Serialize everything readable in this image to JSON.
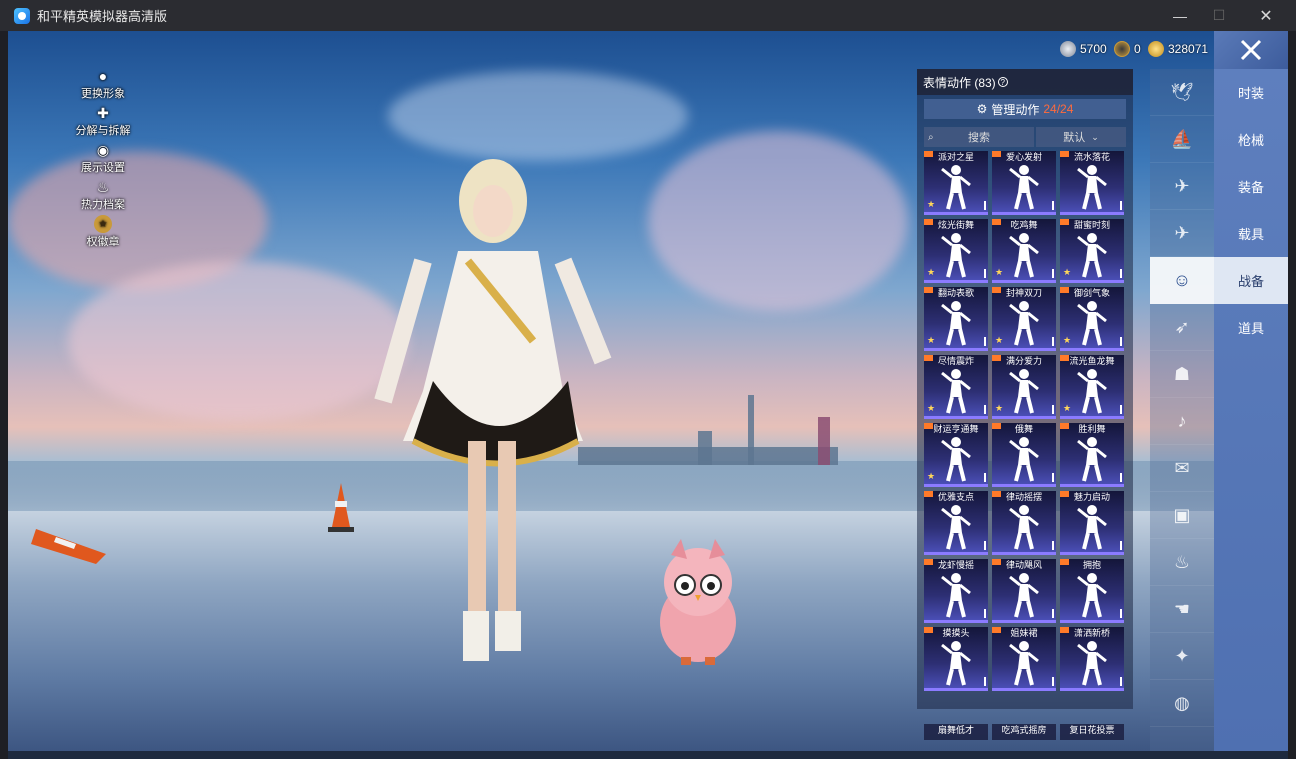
{
  "window": {
    "title": "和平精英模拟器高清版",
    "minimize_icon": "minimize-icon",
    "maximize_icon": "maximize-icon",
    "close_icon": "close-icon"
  },
  "currency": [
    {
      "icon": "silver-coin-icon",
      "value": "5700",
      "color": "#c0c4cc"
    },
    {
      "icon": "medal-coin-icon",
      "value": "0",
      "color": "#c99a3a"
    },
    {
      "icon": "gold-coin-icon",
      "value": "328071",
      "color": "#e2b43a"
    }
  ],
  "left_menu": [
    {
      "icon": "person-icon",
      "label": "更换形象"
    },
    {
      "icon": "puzzle-icon",
      "label": "分解与拆解"
    },
    {
      "icon": "eye-icon",
      "label": "展示设置"
    },
    {
      "icon": "flame-icon",
      "label": "热力档案"
    },
    {
      "icon": "badge-icon",
      "label": "权徽章"
    }
  ],
  "emote_panel": {
    "header": "表情动作 (83)",
    "help_icon": "help-icon",
    "manage_label": "管理动作",
    "manage_count": "24/24",
    "search_placeholder": "搜索",
    "sort_value": "默认",
    "cards": [
      {
        "name": "派对之星",
        "star": true
      },
      {
        "name": "爱心发射",
        "star": false
      },
      {
        "name": "流水落花",
        "star": false
      },
      {
        "name": "炫光街舞",
        "star": true
      },
      {
        "name": "吃鸡舞",
        "star": true
      },
      {
        "name": "甜蜜时刻",
        "star": true
      },
      {
        "name": "翻动表歌",
        "star": true
      },
      {
        "name": "封神双刀",
        "star": true
      },
      {
        "name": "御剑气象",
        "star": true
      },
      {
        "name": "尽情震炸",
        "star": true
      },
      {
        "name": "满分爱力",
        "star": true
      },
      {
        "name": "流光鱼龙舞",
        "star": true
      },
      {
        "name": "财运亨通舞",
        "star": true
      },
      {
        "name": "俄舞",
        "star": false
      },
      {
        "name": "胜利舞",
        "star": false
      },
      {
        "name": "优雅支点",
        "star": false
      },
      {
        "name": "律动摇摆",
        "star": false
      },
      {
        "name": "魅力启动",
        "star": false
      },
      {
        "name": "龙虾慢摇",
        "star": false
      },
      {
        "name": "律动飓风",
        "star": false
      },
      {
        "name": "拥抱",
        "star": false
      },
      {
        "name": "摸摸头",
        "star": false
      },
      {
        "name": "姐妹裙",
        "star": false
      },
      {
        "name": "潇洒新桥",
        "star": false
      }
    ],
    "bottom_row": [
      "扇舞低才",
      "吃鸡式摇房",
      "复日花投票"
    ]
  },
  "icon_column": [
    {
      "icon": "bird-icon",
      "active": false
    },
    {
      "icon": "boat-icon",
      "active": false
    },
    {
      "icon": "drone-icon",
      "active": false
    },
    {
      "icon": "plane-icon",
      "active": false
    },
    {
      "icon": "smiley-icon",
      "active": true
    },
    {
      "icon": "jet-icon",
      "active": false
    },
    {
      "icon": "robot-icon",
      "active": false
    },
    {
      "icon": "speaker-icon",
      "active": false
    },
    {
      "icon": "chat-icon",
      "active": false
    },
    {
      "icon": "photo-icon",
      "active": false
    },
    {
      "icon": "extinguisher-icon",
      "active": false
    },
    {
      "icon": "hand-icon",
      "active": false
    },
    {
      "icon": "wand-icon",
      "active": false
    },
    {
      "icon": "ufo-icon",
      "active": false
    }
  ],
  "categories": [
    {
      "label": "时装",
      "active": false
    },
    {
      "label": "枪械",
      "active": false
    },
    {
      "label": "装备",
      "active": false
    },
    {
      "label": "载具",
      "active": false
    },
    {
      "label": "战备",
      "active": true
    },
    {
      "label": "道具",
      "active": false
    }
  ],
  "colors": {
    "accent": "#ff6b3d",
    "category_bg": "#5e7fbe",
    "active_category_bg": "#dfe7f3"
  }
}
